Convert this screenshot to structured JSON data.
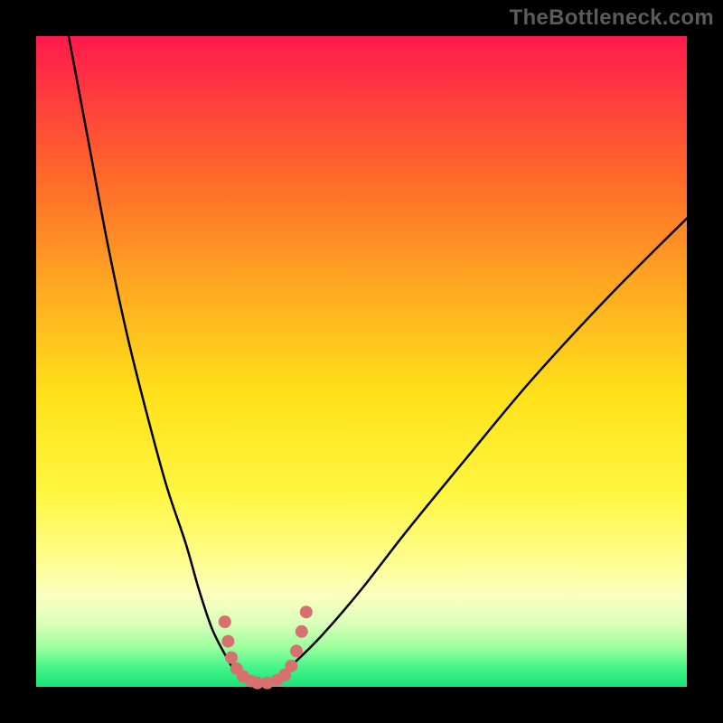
{
  "watermark": "TheBottleneck.com",
  "chart_data": {
    "type": "line",
    "title": "",
    "xlabel": "",
    "ylabel": "",
    "xlim": [
      0,
      100
    ],
    "ylim": [
      0,
      100
    ],
    "grid": false,
    "legend": false,
    "background_gradient": {
      "top": "#ff1a4d",
      "mid": "#ffe11a",
      "bottom": "#18e37a"
    },
    "series": [
      {
        "name": "left-curve",
        "description": "steep descending curve from upper-left to bottom valley",
        "x": [
          5,
          8,
          11,
          14,
          17,
          20,
          23,
          25,
          27,
          29,
          30.5,
          32,
          33.5
        ],
        "y": [
          100,
          84,
          68,
          54,
          42,
          31,
          22,
          15,
          9,
          5,
          2.5,
          1.2,
          0.5
        ]
      },
      {
        "name": "right-curve",
        "description": "curve rising from bottom valley toward upper-right",
        "x": [
          35,
          37,
          40,
          44,
          50,
          57,
          66,
          76,
          88,
          100
        ],
        "y": [
          0.5,
          1.5,
          4,
          8,
          15,
          24,
          35,
          47,
          60,
          72
        ]
      }
    ],
    "markers": {
      "name": "valley-markers",
      "color": "#d6716f",
      "description": "cluster of pink dots near curve minimum forming a U-shape",
      "points": [
        {
          "x": 29.0,
          "y": 10.0,
          "r": 7
        },
        {
          "x": 29.5,
          "y": 7.0,
          "r": 7
        },
        {
          "x": 30.0,
          "y": 4.5,
          "r": 7
        },
        {
          "x": 30.8,
          "y": 2.8,
          "r": 7
        },
        {
          "x": 31.8,
          "y": 1.6,
          "r": 7
        },
        {
          "x": 33.0,
          "y": 0.9,
          "r": 7
        },
        {
          "x": 34.0,
          "y": 0.6,
          "r": 7
        },
        {
          "x": 35.5,
          "y": 0.6,
          "r": 7
        },
        {
          "x": 37.0,
          "y": 1.0,
          "r": 7
        },
        {
          "x": 38.2,
          "y": 1.8,
          "r": 7
        },
        {
          "x": 39.2,
          "y": 3.2,
          "r": 7
        },
        {
          "x": 40.0,
          "y": 5.5,
          "r": 7
        },
        {
          "x": 40.8,
          "y": 8.5,
          "r": 7
        },
        {
          "x": 41.5,
          "y": 11.5,
          "r": 7
        }
      ]
    }
  }
}
